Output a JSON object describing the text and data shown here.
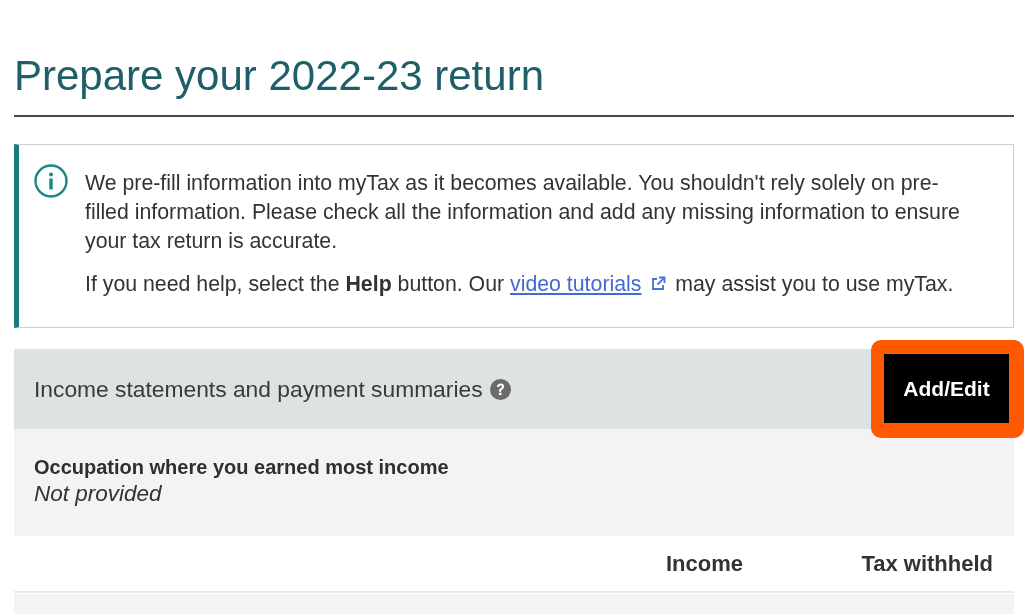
{
  "page_title": "Prepare your 2022-23 return",
  "info_notice": {
    "paragraph": "We pre-fill information into myTax as it becomes available. You shouldn't rely solely on pre-filled information. Please check all the information and add any missing information to ensure your tax return is accurate.",
    "help_text_before": "If you need help, select the **Help** button. Our",
    "link": "video tutorials",
    "help_text_after": "may assist you to use myTax."
  },
  "section": {
    "title": "Income statements and payment summaries",
    "button": {
      "label": "Add/Edit",
      "highlighted": true
    },
    "occupation": {
      "label": "Occupation where you earned most income",
      "value": "Not provided"
    },
    "table": {
      "columns": [
        "Income",
        "Tax withheld"
      ]
    }
  }
}
